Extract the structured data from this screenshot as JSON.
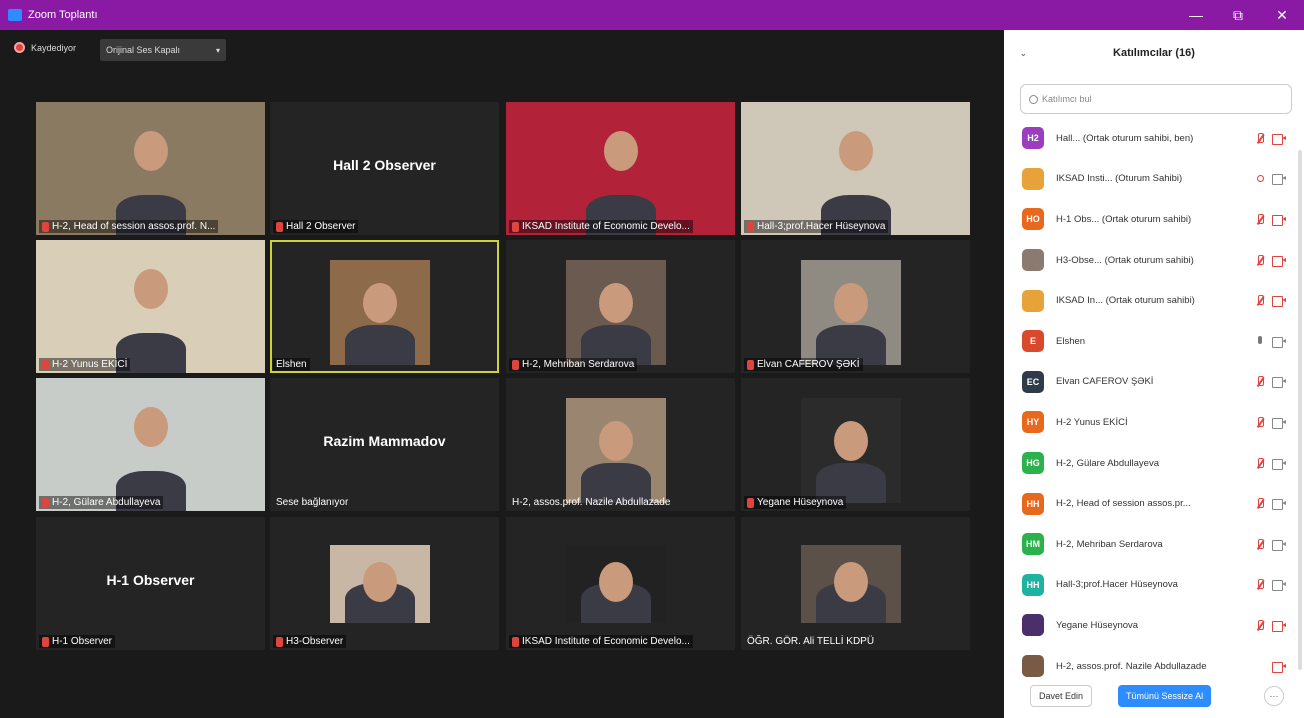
{
  "titlebar": {
    "title": "Zoom Toplantı",
    "min": "—",
    "max": "⧉",
    "close": "✕"
  },
  "recording": {
    "label": "Kaydediyor",
    "audio_label": "Orijinal Ses Kapalı",
    "audio_caret": "▾"
  },
  "tiles": [
    {
      "name": "H-2, Head of session assos.prof. N...",
      "muted": true,
      "kind": "video",
      "bg": "#8a7a62"
    },
    {
      "name": "Hall 2  Observer",
      "muted": true,
      "kind": "text",
      "center": "Hall 2  Observer"
    },
    {
      "name": "IKSAD Institute of Economic Develo...",
      "muted": true,
      "kind": "video",
      "bg": "#b2233a"
    },
    {
      "name": "Hall-3;prof.Hacer Hüseynova",
      "muted": true,
      "kind": "video",
      "bg": "#cfc7b8"
    },
    {
      "name": "H-2 Yunus EKİCİ",
      "muted": true,
      "kind": "video",
      "bg": "#d9cfb8"
    },
    {
      "name": "Elshen",
      "muted": false,
      "kind": "video",
      "bg": "#8d6a4a",
      "active": true
    },
    {
      "name": "H-2, Mehriban Serdarova",
      "muted": true,
      "kind": "video",
      "bg": "#6b5a4f"
    },
    {
      "name": "Elvan CAFEROV ŞƏKİ",
      "muted": true,
      "kind": "video",
      "bg": "#8f8a82"
    },
    {
      "name": "H-2, Gülare Abdullayeva",
      "muted": true,
      "kind": "video",
      "bg": "#c8ccc8"
    },
    {
      "name": "Sese bağlanıyor",
      "muted": false,
      "kind": "text",
      "center": "Razim Mammadov",
      "plain": true
    },
    {
      "name": "H-2, assos.prof. Nazile Abdullazade",
      "muted": false,
      "kind": "video",
      "bg": "#9a8570",
      "plain": true
    },
    {
      "name": "Yegane Hüseynova",
      "muted": true,
      "kind": "video",
      "bg": "#2b2b2b"
    },
    {
      "name": "H-1 Observer",
      "muted": true,
      "kind": "text",
      "center": "H-1 Observer"
    },
    {
      "name": "H3-Observer",
      "muted": true,
      "kind": "video",
      "bg": "#c9b7a5"
    },
    {
      "name": "IKSAD Institute of Economic Develo...",
      "muted": true,
      "kind": "video",
      "bg": "#222222"
    },
    {
      "name": "ÖĞR. GÖR. Ali TELLİ KDPÜ",
      "muted": false,
      "kind": "video",
      "bg": "#5c5148",
      "plain": true
    }
  ],
  "panel": {
    "title": "Katılımcılar (16)",
    "collapse": "⌄",
    "search_placeholder": "Katılımcı bul",
    "invite": "Davet Edin",
    "mute_all": "Tümünü Sessize Al",
    "more": "···"
  },
  "participants": [
    {
      "initials": "H2",
      "color": "#9b3dbd",
      "name": "Hall... (Ortak oturum sahibi, ben)",
      "mic": "muted",
      "cam": "off"
    },
    {
      "initials": "",
      "color": "#e8a23a",
      "name": "IKSAD Insti... (Oturum Sahibi)",
      "mic": "rec",
      "cam": "on",
      "rec": true
    },
    {
      "initials": "HO",
      "color": "#e8681e",
      "name": "H-1 Obs... (Ortak oturum sahibi)",
      "mic": "muted",
      "cam": "off"
    },
    {
      "initials": "",
      "color": "#8a7a70",
      "name": "H3-Obse... (Ortak oturum sahibi)",
      "mic": "muted",
      "cam": "off"
    },
    {
      "initials": "",
      "color": "#e8a23a",
      "name": "IKSAD In... (Ortak oturum sahibi)",
      "mic": "muted",
      "cam": "off"
    },
    {
      "initials": "E",
      "color": "#d94a2c",
      "name": "Elshen",
      "mic": "on",
      "cam": "on"
    },
    {
      "initials": "EC",
      "color": "#2f3b4a",
      "name": "Elvan CAFEROV ŞƏKİ",
      "mic": "muted",
      "cam": "on"
    },
    {
      "initials": "HY",
      "color": "#e8681e",
      "name": "H-2 Yunus EKİCİ",
      "mic": "muted",
      "cam": "on"
    },
    {
      "initials": "HG",
      "color": "#2bb24c",
      "name": "H-2, Gülare Abdullayeva",
      "mic": "muted",
      "cam": "on"
    },
    {
      "initials": "HH",
      "color": "#e8681e",
      "name": "H-2, Head of session assos.pr...",
      "mic": "muted",
      "cam": "on"
    },
    {
      "initials": "HM",
      "color": "#2bb24c",
      "name": "H-2, Mehriban Serdarova",
      "mic": "muted",
      "cam": "on"
    },
    {
      "initials": "HH",
      "color": "#1eb3a0",
      "name": "Hall-3;prof.Hacer Hüseynova",
      "mic": "muted",
      "cam": "on"
    },
    {
      "initials": "",
      "color": "#4a2f6a",
      "name": "Yegane Hüseynova",
      "mic": "muted",
      "cam": "off"
    },
    {
      "initials": "",
      "color": "#7a5a45",
      "name": "H-2, assos.prof. Nazile Abdullazade",
      "mic": "none",
      "cam": "off"
    }
  ]
}
